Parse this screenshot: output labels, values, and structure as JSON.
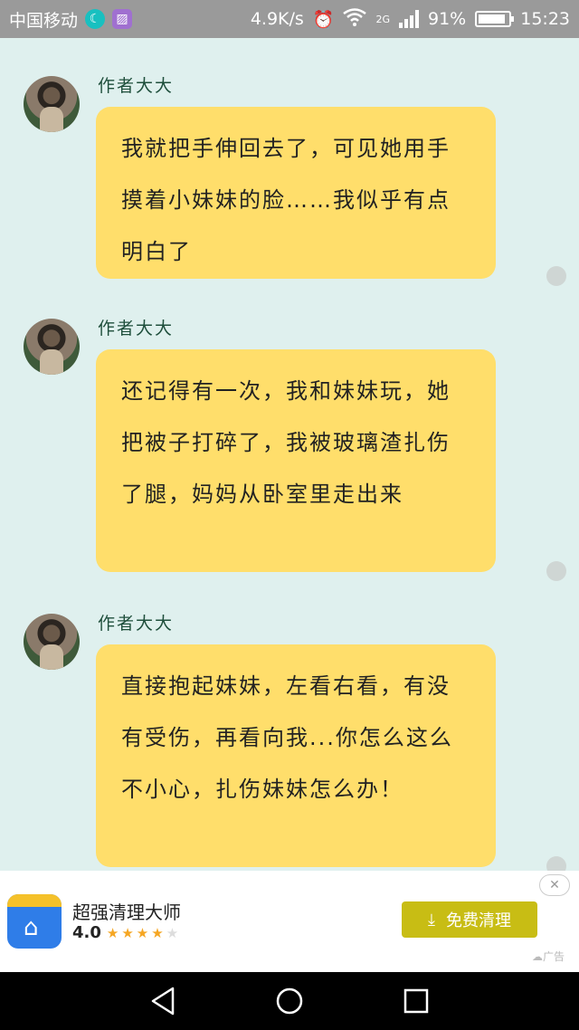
{
  "status_bar": {
    "carrier": "中国移动",
    "speed": "4.9K/s",
    "network": "2G",
    "battery": "91%",
    "battery_level": 0.91,
    "time": "15:23"
  },
  "messages": [
    {
      "author": "作者大大",
      "text": "我就把手伸回去了，可见她用手摸着小妹妹的脸……我似乎有点明白了"
    },
    {
      "author": "作者大大",
      "text": "还记得有一次，我和妹妹玩，她把被子打碎了，我被玻璃渣扎伤了腿，妈妈从卧室里走出来"
    },
    {
      "author": "作者大大",
      "text": "直接抱起妹妹，左看右看，有没有受伤，再看向我...你怎么这么不小心，扎伤妹妹怎么办！"
    }
  ],
  "ad": {
    "title": "超强清理大师",
    "rating": "4.0",
    "stars_filled": 4,
    "stars_total": 5,
    "button_label": "免费清理",
    "tag": "广告"
  },
  "colors": {
    "background": "#dff0ee",
    "bubble": "#ffde6b",
    "author": "#1f4f3c",
    "ad_button": "#c8bd14"
  },
  "icons": {
    "moon": "moon-icon",
    "gallery": "gallery-icon",
    "alarm": "alarm-icon",
    "wifi": "wifi-icon",
    "signal": "signal-icon",
    "battery": "battery-icon",
    "ad_download": "download-icon",
    "ad_close": "close-icon",
    "back": "back-icon",
    "home": "home-icon",
    "recents": "recents-icon"
  }
}
